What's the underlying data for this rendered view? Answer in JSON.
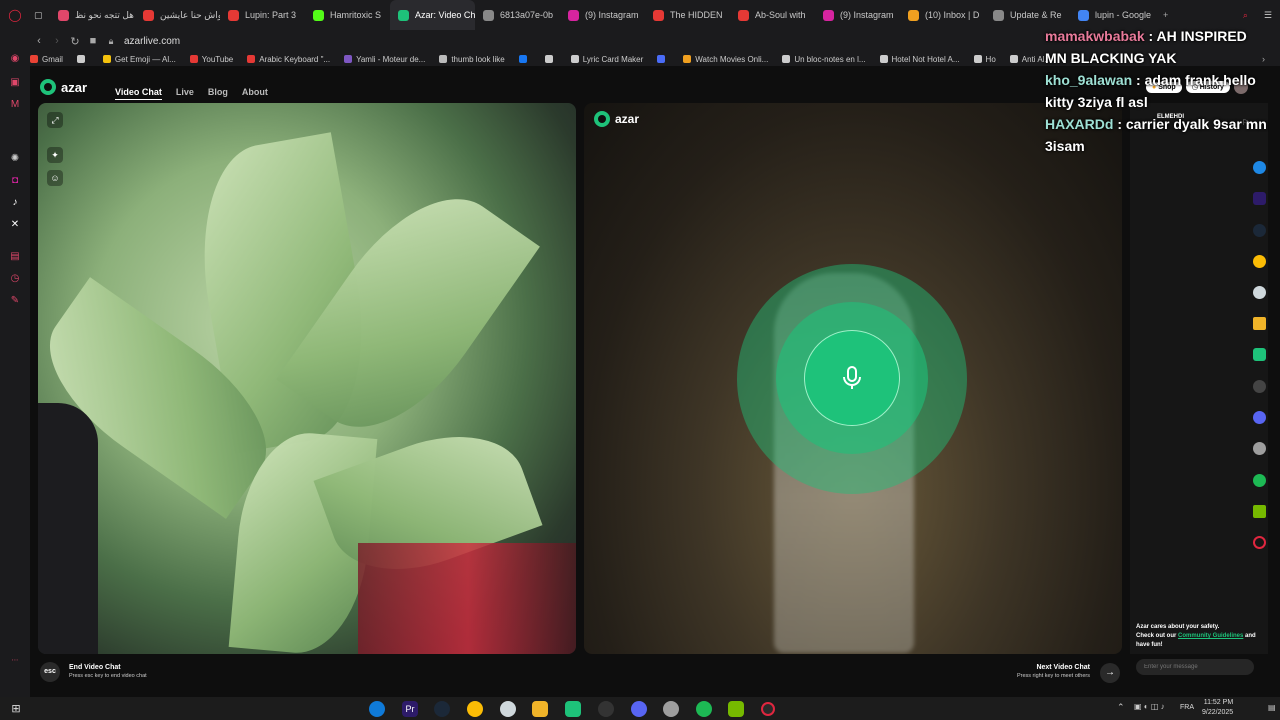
{
  "tabs": [
    {
      "title": "هل تتجه نحو نظ",
      "color": "#e0476a",
      "active": false
    },
    {
      "title": "واش حنا عايشين",
      "color": "#e53935",
      "active": false
    },
    {
      "title": "Lupin: Part 3",
      "color": "#e53935",
      "active": false
    },
    {
      "title": "Hamritoxic S",
      "color": "#53fc18",
      "active": false
    },
    {
      "title": "Azar: Video Chat | A",
      "color": "#1ec27a",
      "active": true
    },
    {
      "title": "6813a07e-0b",
      "color": "#888888",
      "active": false
    },
    {
      "title": "(9) Instagram",
      "color": "#d6249f",
      "active": false
    },
    {
      "title": "The HIDDEN",
      "color": "#e53935",
      "active": false
    },
    {
      "title": "Ab-Soul with",
      "color": "#e53935",
      "active": false
    },
    {
      "title": "(9) Instagram",
      "color": "#d6249f",
      "active": false
    },
    {
      "title": "(10) Inbox | D",
      "color": "#f0a020",
      "active": false
    },
    {
      "title": "Update & Re",
      "color": "#888888",
      "active": false
    },
    {
      "title": "lupin - Google",
      "color": "#4285f4",
      "active": false
    }
  ],
  "address": {
    "url": "azarlive.com"
  },
  "bookmarks": [
    {
      "label": "Gmail",
      "color": "#ea4335"
    },
    {
      "label": "",
      "color": "#cccccc"
    },
    {
      "label": "Get Emoji — Al...",
      "color": "#f4c20d"
    },
    {
      "label": "YouTube",
      "color": "#e53935"
    },
    {
      "label": "Arabic Keyboard \"...",
      "color": "#e53935"
    },
    {
      "label": "Yamli - Moteur de...",
      "color": "#7e57c2"
    },
    {
      "label": "thumb look like",
      "color": "#bbbbbb"
    },
    {
      "label": "",
      "color": "#1877f2"
    },
    {
      "label": "",
      "color": "#cccccc"
    },
    {
      "label": "Lyric Card Maker",
      "color": "#cccccc"
    },
    {
      "label": "",
      "color": "#4a6cf7"
    },
    {
      "label": "Watch Movies Onli...",
      "color": "#f0a020"
    },
    {
      "label": "Un bloc-notes en l...",
      "color": "#cccccc"
    },
    {
      "label": "Hotel Not Hotel A...",
      "color": "#cccccc"
    },
    {
      "label": "Ho",
      "color": "#cccccc"
    },
    {
      "label": "Anti Al...",
      "color": "#cccccc"
    }
  ],
  "site": {
    "brand": "azar",
    "nav": [
      {
        "label": "Video Chat",
        "active": true
      },
      {
        "label": "Live",
        "active": false
      },
      {
        "label": "Blog",
        "active": false
      },
      {
        "label": "About",
        "active": false
      }
    ],
    "shop": "Shop",
    "history": "History",
    "remote_user": "ELMEHDI",
    "safety_text_1": "Azar cares about your safety.",
    "safety_text_2": "Check out our",
    "safety_link": "Community Guidelines",
    "safety_text_3": "and have fun!",
    "message_placeholder": "Enter your message",
    "end_key": "esc",
    "end_title": "End Video Chat",
    "end_sub": "Press esc key to end video chat",
    "next_title": "Next Video Chat",
    "next_sub": "Press right key to meet others",
    "accent": "#1ec27a"
  },
  "overlay_chat": [
    {
      "user": "mamakwbabak",
      "text": " : AH INSPIRED"
    },
    {
      "user": "",
      "text": "MN BLACKING YAK"
    },
    {
      "user": "kho_9alawan",
      "text": " : adam frank hello"
    },
    {
      "user": "",
      "text": "kitty 3ziya fl asl"
    },
    {
      "user": "HAXARDd",
      "text": " : carrier dyalk 9sar mn"
    },
    {
      "user": "",
      "text": "3isam"
    }
  ],
  "taskbar": {
    "lang": "FRA",
    "time": "11:52 PM",
    "date": "9/22/2025"
  }
}
